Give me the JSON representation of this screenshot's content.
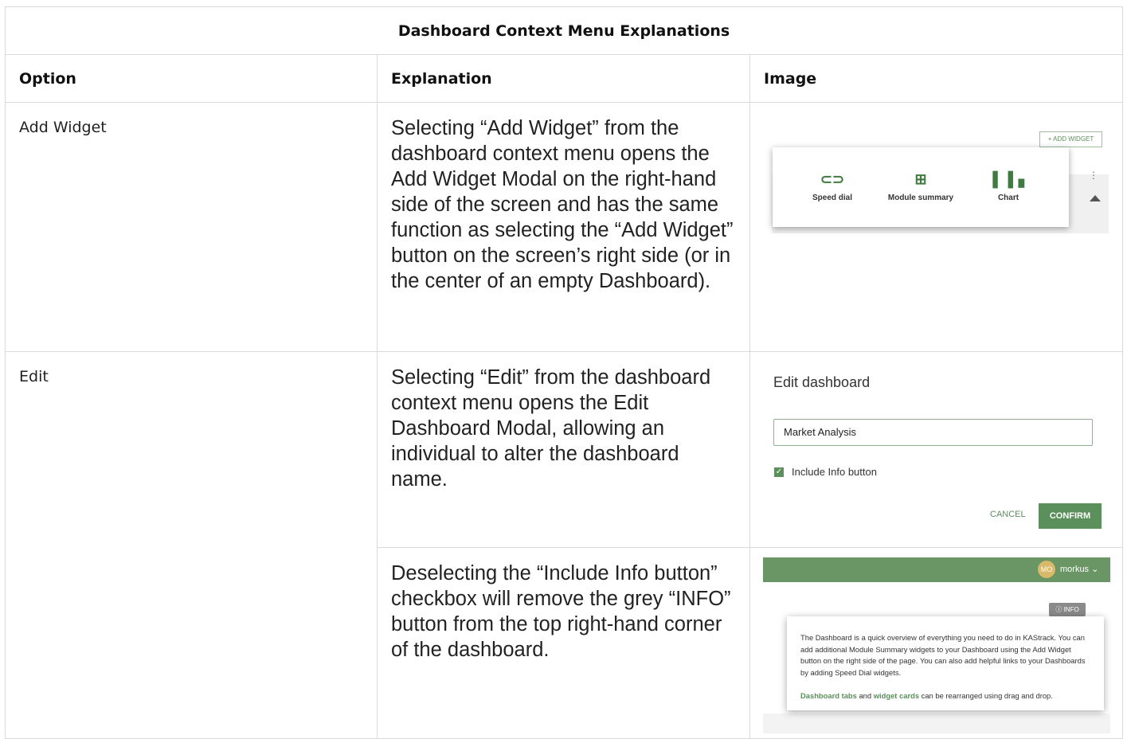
{
  "table": {
    "title": "Dashboard Context Menu Explanations",
    "headers": {
      "option": "Option",
      "explanation": "Explanation",
      "image": "Image"
    },
    "rows": [
      {
        "option": "Add Widget",
        "explanation": "Selecting “Add Widget” from the dashboard context menu opens the Add Widget Modal on the right-hand side of the screen and has the same function as selecting the “Add Widget” button on the screen’s right side (or in the center of an empty Dashboard)."
      },
      {
        "option": "Edit",
        "explanation": "Selecting “Edit” from the dashboard context menu opens the Edit Dashboard Modal, allowing an individual to alter the dashboard name."
      },
      {
        "option": "",
        "explanation": "Deselecting the “Include Info button” checkbox will remove the grey “INFO” button from the top right-hand corner of the dashboard."
      }
    ]
  },
  "image_add_widget": {
    "add_widget_button": "+ ADD WIDGET",
    "options": [
      "Speed dial",
      "Module summary",
      "Chart"
    ],
    "icons": [
      "link-icon",
      "grid-icon",
      "bar-chart-icon"
    ]
  },
  "image_edit": {
    "title": "Edit dashboard",
    "input_value": "Market Analysis",
    "checkbox_label": "Include Info button",
    "checkbox_checked": true,
    "cancel": "CANCEL",
    "confirm": "CONFIRM",
    "accent_color": "#5b8f5b"
  },
  "image_info": {
    "avatar_initials": "MO",
    "username": "morkus",
    "info_button": "INFO",
    "paragraph1": "The Dashboard is a quick overview of everything you need to do in KAStrack. You can add additional Module Summary widgets to your Dashboard using the Add Widget button on the right side of the page. You can also add helpful links to your Dashboards by adding Speed Dial widgets.",
    "link_tabs": "Dashboard tabs",
    "and": "and",
    "link_cards": "widget cards",
    "rest": "can be rearranged using drag and drop.",
    "header_color": "#6a9665"
  }
}
